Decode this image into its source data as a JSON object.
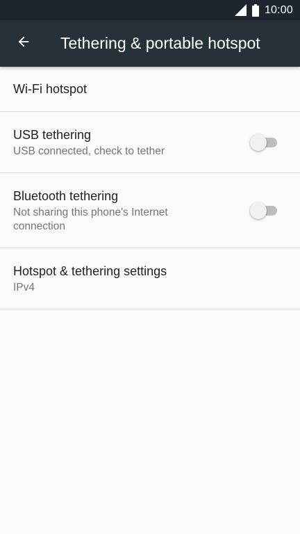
{
  "status_bar": {
    "time": "10:00",
    "signal_icon": "cell-signal-icon",
    "battery_icon": "battery-icon"
  },
  "app_bar": {
    "back_icon": "arrow-back-icon",
    "title": "Tethering & portable hotspot",
    "background": "#263238"
  },
  "settings": {
    "items": [
      {
        "title": "Wi-Fi hotspot",
        "summary": ""
      },
      {
        "title": "USB tethering",
        "summary": "USB connected, check to tether",
        "toggle_on": false
      },
      {
        "title": "Bluetooth tethering",
        "summary": "Not sharing this phone's Internet connection",
        "toggle_on": false
      },
      {
        "title": "Hotspot & tethering settings",
        "summary": "IPv4"
      }
    ]
  }
}
